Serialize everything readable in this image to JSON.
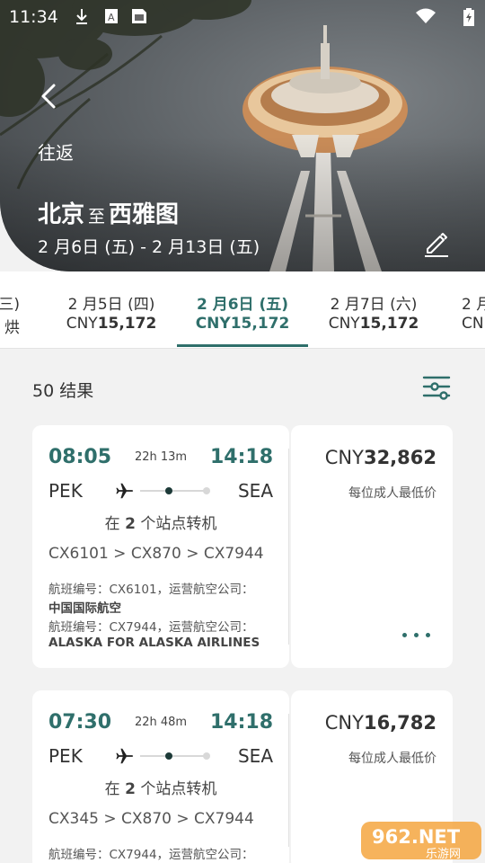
{
  "status_bar": {
    "time": "11:34"
  },
  "header": {
    "trip_type": "往返",
    "origin": "北京",
    "separator": "至",
    "destination": "西雅图",
    "date_range": "2 月6日 (五) - 2 月13日 (五)"
  },
  "date_tabs": [
    {
      "date": "三)",
      "currency": "",
      "price": "烘"
    },
    {
      "date": "2 月5日 (四)",
      "currency": "CNY",
      "price": "15,172"
    },
    {
      "date": "2 月6日 (五)",
      "currency": "CNY",
      "price": "15,172",
      "selected": true
    },
    {
      "date": "2 月7日 (六)",
      "currency": "CNY",
      "price": "15,172"
    },
    {
      "date": "2 月",
      "currency": "CN",
      "price": ""
    }
  ],
  "results": {
    "count_label": "50 结果"
  },
  "flights": [
    {
      "depart_time": "08:05",
      "duration": "22h 13m",
      "arrive_time": "14:18",
      "origin": "PEK",
      "destination": "SEA",
      "stops_prefix": "在",
      "stops_count": "2",
      "stops_suffix": "个站点转机",
      "flight_numbers": "CX6101 > CX870 > CX7944",
      "operators": [
        {
          "line": "航班编号：CX6101，运营航空公司：",
          "name": "中国国际航空"
        },
        {
          "line": "航班编号：CX7944，运营航空公司：",
          "name": "ALASKA FOR ALASKA AIRLINES"
        }
      ],
      "currency": "CNY",
      "price": "32,862",
      "price_note": "每位成人最低价"
    },
    {
      "depart_time": "07:30",
      "duration": "22h 48m",
      "arrive_time": "14:18",
      "origin": "PEK",
      "destination": "SEA",
      "stops_prefix": "在",
      "stops_count": "2",
      "stops_suffix": "个站点转机",
      "flight_numbers": "CX345 > CX870 > CX7944",
      "operators": [
        {
          "line": "航班编号：CX7944，运营航空公司：",
          "name": ""
        }
      ],
      "currency": "CNY",
      "price": "16,782",
      "price_note": "每位成人最低价"
    }
  ],
  "watermark": {
    "text": "962.NET",
    "subtext": "乐游网"
  },
  "colors": {
    "accent": "#2f6f6b",
    "background": "#f2f2f2",
    "card": "#ffffff"
  }
}
